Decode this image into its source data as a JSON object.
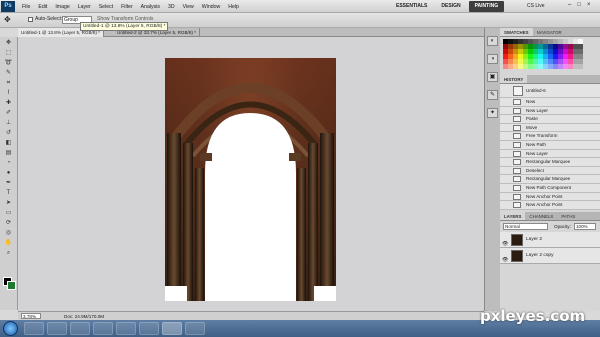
{
  "app": {
    "logo": "Ps"
  },
  "menus": [
    "File",
    "Edit",
    "Image",
    "Layer",
    "Select",
    "Filter",
    "Analysis",
    "3D",
    "View",
    "Window",
    "Help"
  ],
  "workspace": {
    "buttons": [
      "ESSENTIALS",
      "DESIGN",
      "PAINTING"
    ],
    "active": "PAINTING",
    "cslive": "CS Live"
  },
  "options": {
    "auto_select": "Auto-Select:",
    "group": "Group",
    "transform": "Show Transform Controls"
  },
  "tabs": [
    {
      "label": "Untitled-1 @ 13.8% (Layer 5, RGB/8) *"
    },
    {
      "label": "Untitled-2 @ 33.7% (Layer 5, RGB/8) *"
    }
  ],
  "tooltip": "Untitled-1 @ 13.8% (Layer 5, RGB/8) *",
  "status": {
    "zoom": "3.78%",
    "doc": "Doc: 24.9M/170.0M"
  },
  "swatches": {
    "tabs": [
      "SWATCHES",
      "NAVIGATOR"
    ]
  },
  "history": {
    "tab": "HISTORY",
    "snapshot": "Untitled-6",
    "items": [
      "New",
      "New Layer",
      "Paste",
      "Move",
      "Free Transform",
      "New Path",
      "New Layer",
      "Rectangular Marquee",
      "Deselect",
      "Rectangular Marquee",
      "New Path Component",
      "New Anchor Point",
      "New Anchor Point"
    ]
  },
  "layers": {
    "tabs": [
      "LAYERS",
      "CHANNELS",
      "PATHS"
    ],
    "blend": "Normal",
    "opacity_label": "Opacity:",
    "opacity": "100%",
    "items": [
      "Layer 2",
      "Layer 2 copy"
    ]
  },
  "watermark": "pxleyes.com"
}
